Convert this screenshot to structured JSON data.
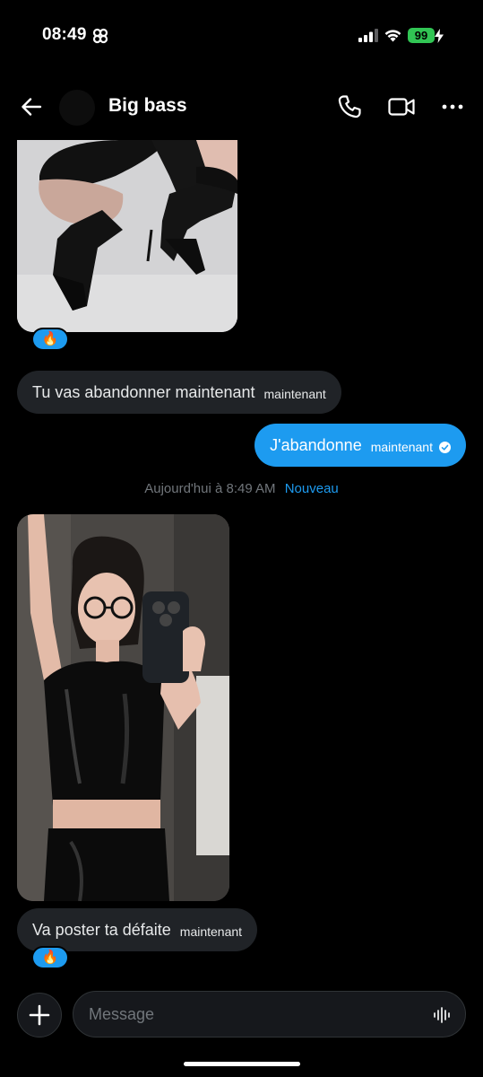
{
  "status_bar": {
    "time": "08:49",
    "battery": "99",
    "icons": [
      "focus-icon",
      "signal-icon",
      "wifi-icon",
      "battery-icon",
      "charging-bolt-icon"
    ]
  },
  "header": {
    "title": "Big bass",
    "icons": [
      "back-arrow-icon",
      "phone-icon",
      "video-camera-icon",
      "more-icon"
    ]
  },
  "messages": [
    {
      "type": "image",
      "direction": "incoming",
      "description": "photo",
      "reaction": "🔥"
    },
    {
      "type": "text",
      "direction": "incoming",
      "text": "Tu vas abandonner maintenant",
      "time": "maintenant"
    },
    {
      "type": "text",
      "direction": "outgoing",
      "text": "J'abandonne",
      "time": "maintenant",
      "status_icon": "read-check-icon"
    },
    {
      "type": "image",
      "direction": "incoming",
      "description": "photo"
    },
    {
      "type": "text",
      "direction": "incoming",
      "text": "Va poster ta défaite",
      "time": "maintenant",
      "reaction": "🔥"
    }
  ],
  "divider": {
    "date": "Aujourd'hui à 8:49 AM",
    "new_label": "Nouveau"
  },
  "composer": {
    "placeholder": "Message"
  },
  "colors": {
    "background": "#000000",
    "accent": "#1d9bf0",
    "incoming_bubble": "#202327",
    "muted_text": "#71767b",
    "battery": "#31c554"
  }
}
